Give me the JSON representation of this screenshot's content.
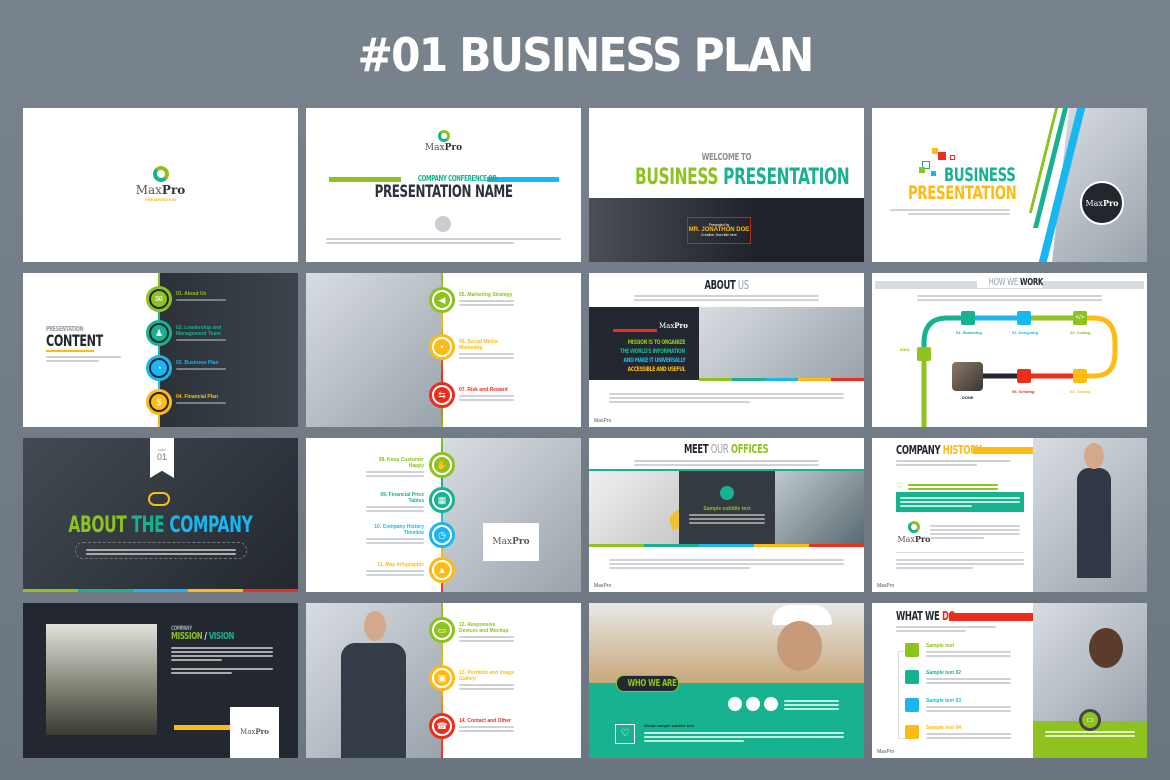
{
  "page_title": "#01 BUSINESS PLAN",
  "colors": {
    "green": "#8dc21f",
    "teal": "#17b28f",
    "blue": "#1ab6ef",
    "yellow": "#fdbb13",
    "red": "#ee2d1c",
    "dark": "#232830"
  },
  "logo": {
    "name_light": "Max",
    "name_bold": "Pro",
    "sub": "PRESENTATION"
  },
  "slides": {
    "s1": {
      "label": "logo slide"
    },
    "s2": {
      "subtitle": "COMPANY CONFERENCE OR",
      "title": "PRESENTATION NAME"
    },
    "s3": {
      "welcome": "WELCOME TO",
      "title_a": "BUSINESS",
      "title_b": "PRESENTATION",
      "presented": "Presented by",
      "name": "MR. JONATHON DOE",
      "role": "Creative Jhon title here"
    },
    "s4": {
      "title_a": "BUSINESS",
      "title_b": "PRESENTATION"
    },
    "s5": {
      "kicker": "PRESENTATION",
      "title": "CONTENT",
      "items": [
        "01. About Us",
        "02. Leadership and Management Team",
        "03. Business Plan",
        "04. Financial Plan"
      ]
    },
    "s6": {
      "items": [
        "05. Marketing Strategy",
        "06. Social Media Marketing",
        "07. Risk and Reward"
      ]
    },
    "s7": {
      "title_a": "ABOUT",
      "title_b": "US",
      "mission": [
        "MISSION IS TO ORGANIZE",
        "THE WORLD'S INFORMATION",
        "AND MAKE IT UNIVERSALLY",
        "ACCESSIBLE AND USEFUL"
      ]
    },
    "s8": {
      "title_a": "HOW WE",
      "title_b": "WORK",
      "steps": [
        "IDEA",
        "01. Sketching",
        "02. Designing",
        "03. Coding",
        "04. Testing",
        "05. Sending",
        "DONE"
      ]
    },
    "s9": {
      "fact": "FACT",
      "fact_num": "01",
      "title_a": "ABOUT",
      "title_b": "THE",
      "title_c": "COMPANY"
    },
    "s10": {
      "items": [
        "08. Keep Customer Happy",
        "09. Financial Price Tables",
        "10. Company History Timeline",
        "11. Map Infographic"
      ]
    },
    "s11": {
      "title_a": "MEET",
      "title_b": "OUR",
      "title_c": "OFFICES",
      "subtitle": "Sample subtitle text"
    },
    "s12": {
      "title_a": "COMPANY",
      "title_b": "HISTORY"
    },
    "s13": {
      "kicker": "COMPANY",
      "title_a": "MISSION",
      "title_b": "/",
      "title_c": "VISION"
    },
    "s14": {
      "items": [
        "12. Responsive Devices and Mockup",
        "13. Portfolio and Image Gallery",
        "14. Contact and Other"
      ]
    },
    "s15": {
      "badge": "WHO WE ARE",
      "subtitle": "About sample subtitle text"
    },
    "s16": {
      "title_a": "WHAT WE",
      "title_b": "DO",
      "items": [
        "Sample text",
        "Sample text 02",
        "Sample text 03",
        "Sample text 04"
      ]
    }
  }
}
